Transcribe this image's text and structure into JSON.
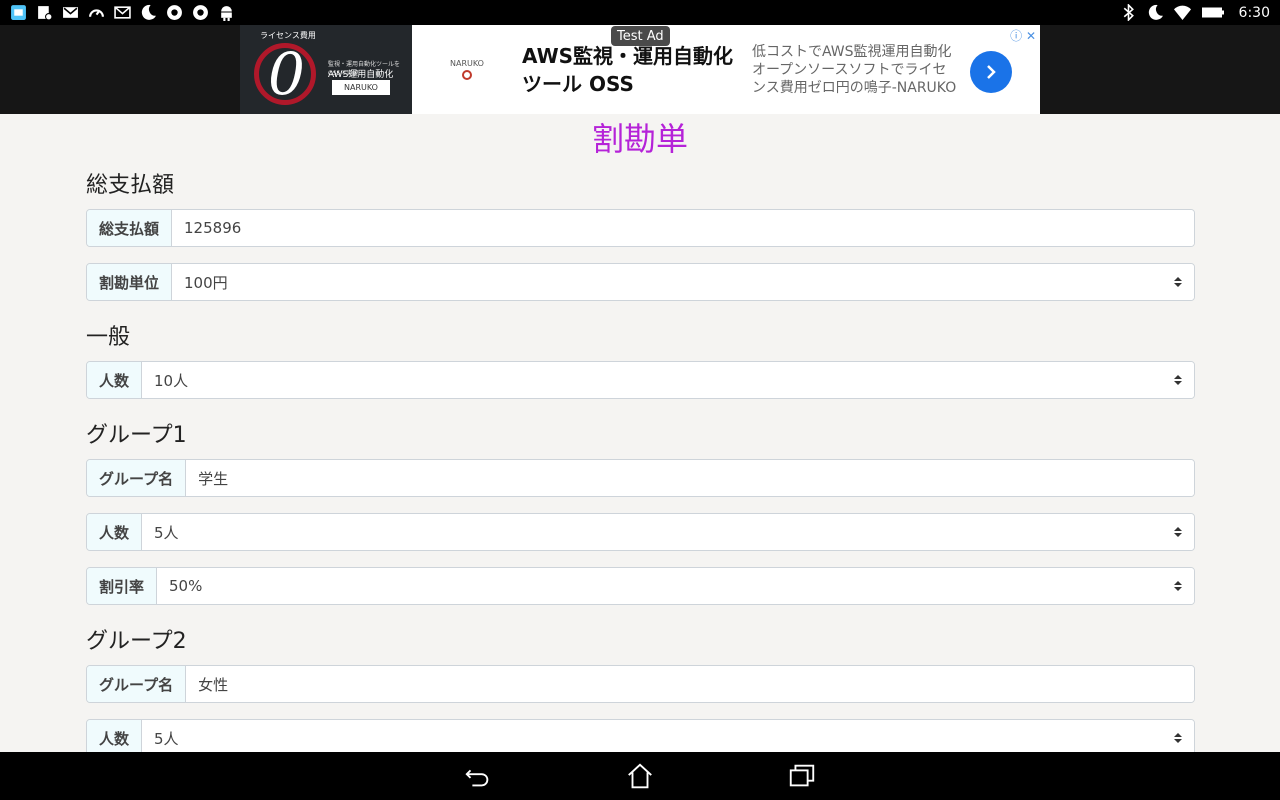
{
  "status_bar": {
    "time": "6:30",
    "left_icons": [
      "app-icon",
      "notification-icon",
      "gmail-icon",
      "speedometer-icon",
      "mail-icon",
      "moon-icon",
      "chrome-icon",
      "chrome-icon",
      "android-icon"
    ],
    "right_icons": [
      "bluetooth-icon",
      "moon-icon",
      "wifi-icon",
      "battery-icon"
    ]
  },
  "ad": {
    "label": "Test Ad",
    "image_text_top": "ライセンス費用",
    "image_zero": "0",
    "image_text_small": "監視・運用自動化ツールをOSSで実現",
    "image_text_mid": "AWS運用自動化",
    "image_badge": "NARUKO",
    "logo_text": "NARUKO",
    "headline": "AWS監視・運用自動化ツール OSS",
    "body": "低コストでAWS監視運用自動化オープンソースソフトでライセンス費用ゼロ円の鳴子-NARUKO",
    "info_icon": "info-icon",
    "close_icon": "close-icon"
  },
  "page": {
    "title": "割勘単"
  },
  "sections": {
    "total": {
      "heading": "総支払額",
      "total_label": "総支払額",
      "total_value": "125896",
      "unit_label": "割勘単位",
      "unit_value": "100円"
    },
    "general": {
      "heading": "一般",
      "people_label": "人数",
      "people_value": "10人"
    },
    "group1": {
      "heading": "グループ1",
      "name_label": "グループ名",
      "name_value": "学生",
      "people_label": "人数",
      "people_value": "5人",
      "discount_label": "割引率",
      "discount_value": "50%"
    },
    "group2": {
      "heading": "グループ2",
      "name_label": "グループ名",
      "name_value": "女性",
      "people_label": "人数",
      "people_value": "5人"
    }
  },
  "nav": {
    "back_icon": "back-icon",
    "home_icon": "home-icon",
    "recents_icon": "recents-icon"
  }
}
